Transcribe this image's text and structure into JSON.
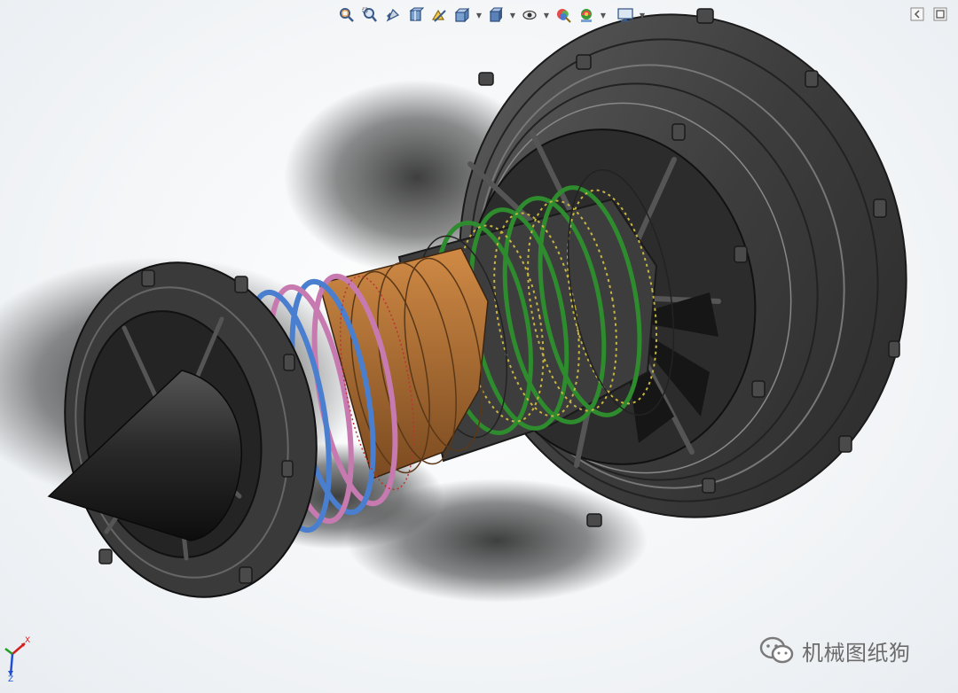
{
  "viewport": {
    "name": "graphics-area",
    "background": "#ffffff"
  },
  "heads_up_toolbar": {
    "buttons": [
      {
        "name": "zoom-to-fit-icon",
        "has_dropdown": false
      },
      {
        "name": "zoom-to-area-icon",
        "has_dropdown": false
      },
      {
        "name": "previous-view-icon",
        "has_dropdown": false
      },
      {
        "name": "section-view-icon",
        "has_dropdown": false
      },
      {
        "name": "dynamic-annotation-icon",
        "has_dropdown": false
      },
      {
        "name": "view-orientation-icon",
        "has_dropdown": true
      },
      {
        "name": "display-style-icon",
        "has_dropdown": true
      },
      {
        "name": "hide-show-items-icon",
        "has_dropdown": true
      },
      {
        "name": "edit-appearance-icon",
        "has_dropdown": false
      },
      {
        "name": "apply-scene-icon",
        "has_dropdown": true
      },
      {
        "name": "view-settings-icon",
        "has_dropdown": true
      }
    ]
  },
  "model": {
    "name": "turbofan-engine-assembly",
    "colors": {
      "casing": "#3a3a3a",
      "nose_cone": "#1c1c1c",
      "compressor_green": "#2e8b2e",
      "combustor_orange": "#c07a3a",
      "turbine_blue": "#4a7fd0",
      "turbine_pink": "#c77ab0",
      "blade_yellow": "#c9b640"
    }
  },
  "triad": {
    "x_label": "X",
    "z_label": "Z"
  },
  "watermark": {
    "text": "机械图纸狗"
  }
}
